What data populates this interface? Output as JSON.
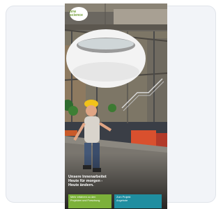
{
  "ad": {
    "logo_text": "nrw\nscience",
    "headline": "Unsere Innenarbeitet\nHeute für morgen -\nHeute ändern.",
    "cta_green": "Mehr erfahren zu den\nProjekten und Forschung",
    "cta_teal": "Zum Projekt\nAngebote"
  },
  "colors": {
    "card_background": "#f2f4f8",
    "cta_green": "#7cb13a",
    "cta_teal": "#1f8ea0",
    "logo_green": "#6c9a2f"
  }
}
